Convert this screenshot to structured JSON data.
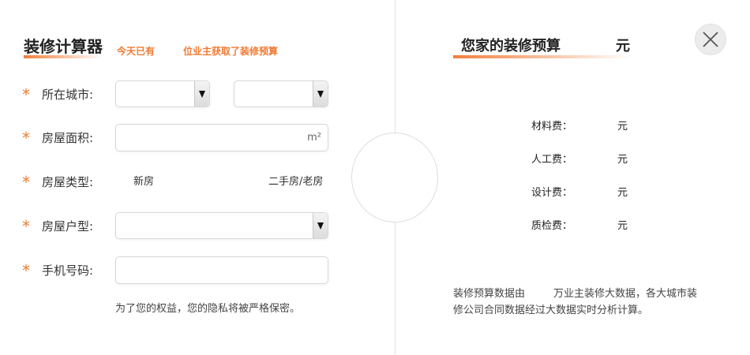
{
  "left": {
    "title": "装修计算器",
    "today_prefix": "今天已有",
    "today_suffix": "位业主获取了装修预算",
    "fields": {
      "city": {
        "label": "所在城市:"
      },
      "area": {
        "label": "房屋面积:",
        "unit": "m²"
      },
      "house_type": {
        "label": "房屋类型:",
        "options": [
          "新房",
          "二手房/老房"
        ]
      },
      "layout": {
        "label": "房屋户型:"
      },
      "phone": {
        "label": "手机号码:"
      }
    },
    "required_mark": "*",
    "privacy_note": "为了您的权益，您的隐私将被严格保密。"
  },
  "right": {
    "title": "您家的装修预算",
    "title_unit": "元",
    "fees": [
      {
        "label": "材料费：",
        "unit": "元"
      },
      {
        "label": "人工费：",
        "unit": "元"
      },
      {
        "label": "设计费：",
        "unit": "元"
      },
      {
        "label": "质检费：",
        "unit": "元"
      }
    ],
    "note_prefix": "装修预算数据由",
    "note_suffix": "万业主装修大数据，各大城市装修公司合同数据经过大数据实时分析计算。"
  },
  "colors": {
    "accent": "#f07a32",
    "divider": "#e2e2e2",
    "close_bg": "#ececec"
  },
  "icons": {
    "close": "close-icon",
    "dropdown": "chevron-down-icon"
  }
}
